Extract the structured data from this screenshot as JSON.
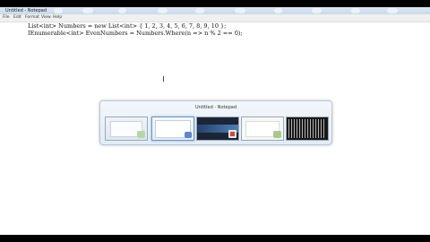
{
  "window": {
    "title": "Untitled - Notepad"
  },
  "menu": [
    "File",
    "Edit",
    "Format",
    "View",
    "Help"
  ],
  "editor": {
    "lines": [
      "List<int> Numbers = new List<int> { 1, 2, 3, 4, 5, 6, 7, 8, 9, 10 };",
      "IEnumerable<int> EvenNumbers = Numbers.Where(n => n % 2 == 0);"
    ]
  },
  "switcher": {
    "label": "Untitled - Notepad",
    "windows": [
      {
        "name": "window-thumbnail",
        "icon": "app-icon"
      },
      {
        "name": "notepad-thumbnail",
        "icon": "notepad-icon"
      },
      {
        "name": "presentation-thumbnail",
        "icon": "office-icon"
      },
      {
        "name": "document-thumbnail",
        "icon": "app-icon"
      },
      {
        "name": "console-thumbnail",
        "icon": "console-icon"
      }
    ]
  }
}
